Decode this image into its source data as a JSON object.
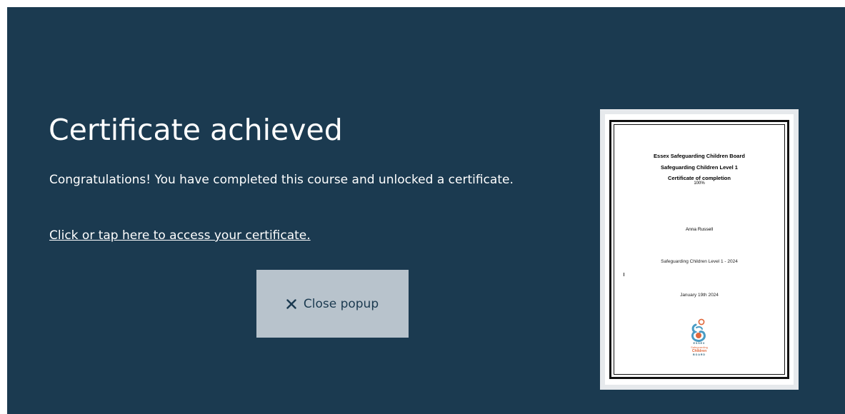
{
  "popup": {
    "title": "Certificate achieved",
    "message": "Congratulations! You have completed this course and unlocked a certificate.",
    "certificate_link": "Click or tap here to access your certificate.",
    "close_button": {
      "label": "Close popup",
      "icon": "close-icon"
    }
  },
  "certificate": {
    "board": "Essex Safeguarding Children Board",
    "course": "Safeguarding Children Level 1",
    "heading": "Certificate of completion",
    "score": "100%",
    "recipient": "Anna Russell",
    "course_name": "Safeguarding Children Level 1 - 2024",
    "date": "January 19th 2024",
    "logo": {
      "icon": "essex-safeguarding-logo",
      "line1": "ESSEX",
      "line2": "Safeguarding",
      "line3": "Children",
      "line4": "BOARD"
    }
  },
  "colors": {
    "background": "#1b3a50",
    "button": "#b8c3cc",
    "text": "#ffffff",
    "logo_blue": "#4a9cc4",
    "logo_orange": "#e0673a"
  }
}
